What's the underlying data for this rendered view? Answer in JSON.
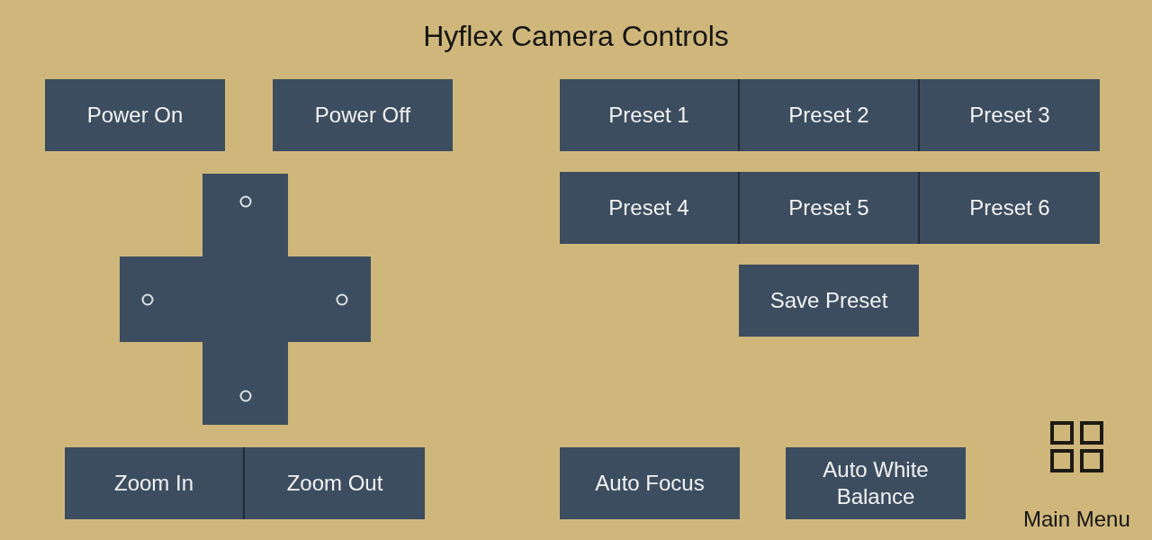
{
  "title": "Hyflex Camera Controls",
  "power_buttons": [
    {
      "label": "Power On"
    },
    {
      "label": "Power Off"
    }
  ],
  "zoom_buttons": [
    {
      "label": "Zoom In"
    },
    {
      "label": "Zoom Out"
    }
  ],
  "presets": [
    {
      "label": "Preset 1"
    },
    {
      "label": "Preset 2"
    },
    {
      "label": "Preset 3"
    },
    {
      "label": "Preset 4"
    },
    {
      "label": "Preset 5"
    },
    {
      "label": "Preset 6"
    }
  ],
  "save_preset": {
    "label": "Save Preset"
  },
  "camera_buttons": [
    {
      "label": "Auto Focus"
    },
    {
      "label": "Auto White Balance"
    }
  ],
  "main_menu": {
    "label": "Main Menu"
  }
}
